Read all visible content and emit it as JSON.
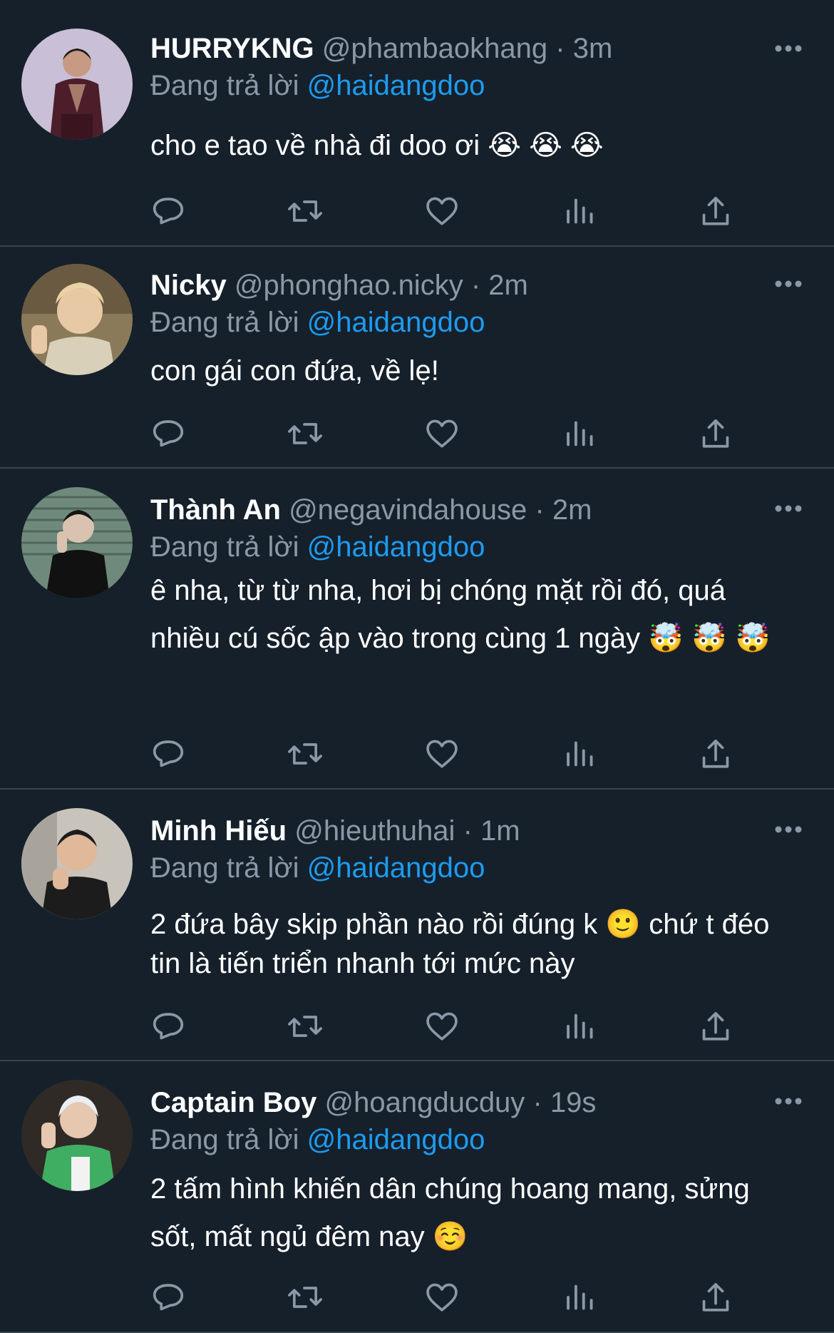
{
  "tweets": [
    {
      "name": "HURRYKNG",
      "handle": "@phambaokhang",
      "dot": "·",
      "time": "3m",
      "reply_prefix": "Đang trả lời ",
      "reply_to": "@haidangdoo",
      "text": "cho e tao về nhà đi doo ơi 😭 😭 😭",
      "avatar_colors": [
        "#c9bfd6",
        "#4b1e2a"
      ]
    },
    {
      "name": "Nicky",
      "handle": "@phonghao.nicky",
      "dot": "·",
      "time": "2m",
      "reply_prefix": "Đang trả lời ",
      "reply_to": "@haidangdoo",
      "text": "con gái con đứa, về lẹ!",
      "avatar_colors": [
        "#8a7a5a",
        "#e8d2a6"
      ]
    },
    {
      "name": "Thành An",
      "handle": "@negavindahouse",
      "dot": "·",
      "time": "2m",
      "reply_prefix": "Đang trả lời ",
      "reply_to": "@haidangdoo",
      "text": "ê nha, từ từ nha, hơi bị chóng mặt rồi đó, quá nhiều cú sốc ập vào trong cùng 1 ngày 🤯 🤯 🤯",
      "avatar_colors": [
        "#6f8a7c",
        "#111111"
      ]
    },
    {
      "name": "Minh Hiếu",
      "handle": "@hieuthuhai",
      "dot": "·",
      "time": "1m",
      "reply_prefix": "Đang trả lời ",
      "reply_to": "@haidangdoo",
      "text": "2 đứa bây skip phần nào rồi đúng k 🙂  chứ t đéo tin là tiến triển nhanh tới mức này",
      "avatar_colors": [
        "#c9c4bb",
        "#1c1c1c"
      ]
    },
    {
      "name": "Captain Boy",
      "handle": "@hoangducduy",
      "dot": "·",
      "time": "19s",
      "reply_prefix": "Đang trả lời ",
      "reply_to": "@haidangdoo",
      "text": "2 tấm hình khiến dân chúng hoang mang, sửng sốt, mất ngủ đêm nay ☺️",
      "avatar_colors": [
        "#2f2a26",
        "#3fae63"
      ]
    }
  ],
  "actions": [
    "reply-icon",
    "retweet-icon",
    "like-icon",
    "analytics-icon",
    "share-icon"
  ],
  "colors": {
    "background": "#15202b",
    "divider": "#38444d",
    "muted": "#8b98a5",
    "link": "#1d9bf0"
  }
}
